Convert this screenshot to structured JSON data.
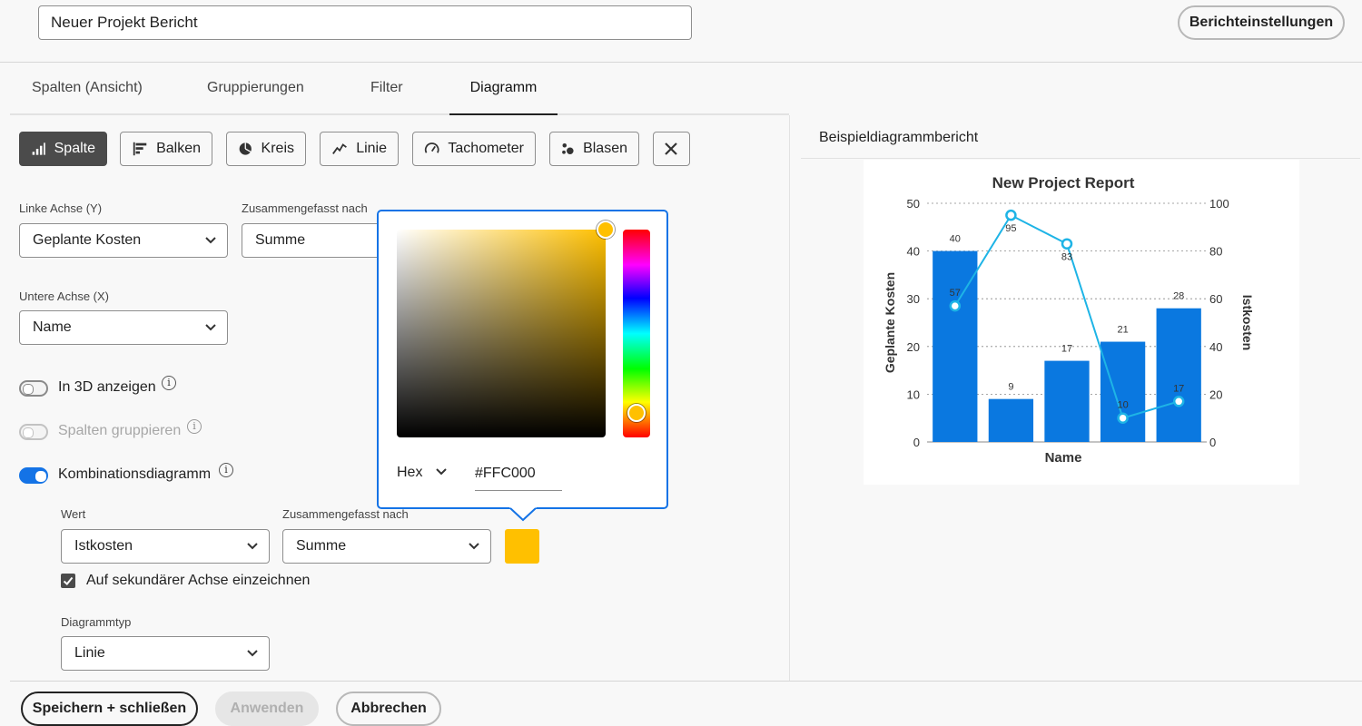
{
  "report_title": "Neuer Projekt Bericht",
  "settings_button": "Berichteinstellungen",
  "tabs": [
    {
      "label": "Spalten (Ansicht)",
      "active": false
    },
    {
      "label": "Gruppierungen",
      "active": false
    },
    {
      "label": "Filter",
      "active": false
    },
    {
      "label": "Diagramm",
      "active": true
    }
  ],
  "chart_types": [
    {
      "label": "Spalte",
      "icon": "column-chart-icon",
      "selected": true
    },
    {
      "label": "Balken",
      "icon": "bar-chart-icon",
      "selected": false
    },
    {
      "label": "Kreis",
      "icon": "pie-chart-icon",
      "selected": false
    },
    {
      "label": "Linie",
      "icon": "line-chart-icon",
      "selected": false
    },
    {
      "label": "Tachometer",
      "icon": "gauge-icon",
      "selected": false
    },
    {
      "label": "Blasen",
      "icon": "bubble-chart-icon",
      "selected": false
    }
  ],
  "left_axis": {
    "label": "Linke Achse (Y)",
    "value": "Geplante Kosten"
  },
  "left_aggregate": {
    "label": "Zusammengefasst nach",
    "value": "Summe"
  },
  "bottom_axis": {
    "label": "Untere Achse (X)",
    "value": "Name"
  },
  "toggles": {
    "show_3d": {
      "label": "In 3D anzeigen",
      "on": false,
      "disabled": false
    },
    "group_columns": {
      "label": "Spalten gruppieren",
      "on": false,
      "disabled": true
    },
    "combo": {
      "label": "Kombinationsdiagramm",
      "on": true,
      "disabled": false
    }
  },
  "combo": {
    "value_label": "Wert",
    "value": "Istkosten",
    "aggregate_label": "Zusammengefasst nach",
    "aggregate": "Summe",
    "color": "#FFC000",
    "secondary_axis_label": "Auf sekundärer Achse einzeichnen",
    "secondary_axis_checked": true,
    "chart_type_label": "Diagrammtyp",
    "chart_type": "Linie"
  },
  "color_picker": {
    "format": "Hex",
    "hex_value": "#FFC000",
    "accent": "#1473E6"
  },
  "footer": {
    "save": "Speichern + schließen",
    "apply": "Anwenden",
    "cancel": "Abbrechen"
  },
  "preview": {
    "title": "Beispieldiagrammbericht"
  },
  "chart_data": {
    "type": "bar",
    "title": "New Project Report",
    "xlabel": "Name",
    "ylabel": "Geplante Kosten",
    "y2label": "Istkosten",
    "ylim": [
      0,
      50
    ],
    "y2lim": [
      0,
      100
    ],
    "yticks": [
      0,
      10,
      20,
      30,
      40,
      50
    ],
    "y2ticks": [
      0,
      20,
      40,
      60,
      80,
      100
    ],
    "grid": true,
    "bar_color": "#0A78E0",
    "line_color": "#1EB4E6",
    "series": [
      {
        "name": "Geplante Kosten",
        "type": "bar",
        "axis": "left",
        "values": [
          40,
          9,
          17,
          21,
          28
        ]
      },
      {
        "name": "Istkosten",
        "type": "line",
        "axis": "right",
        "values": [
          57,
          95,
          83,
          10,
          17
        ]
      }
    ]
  }
}
